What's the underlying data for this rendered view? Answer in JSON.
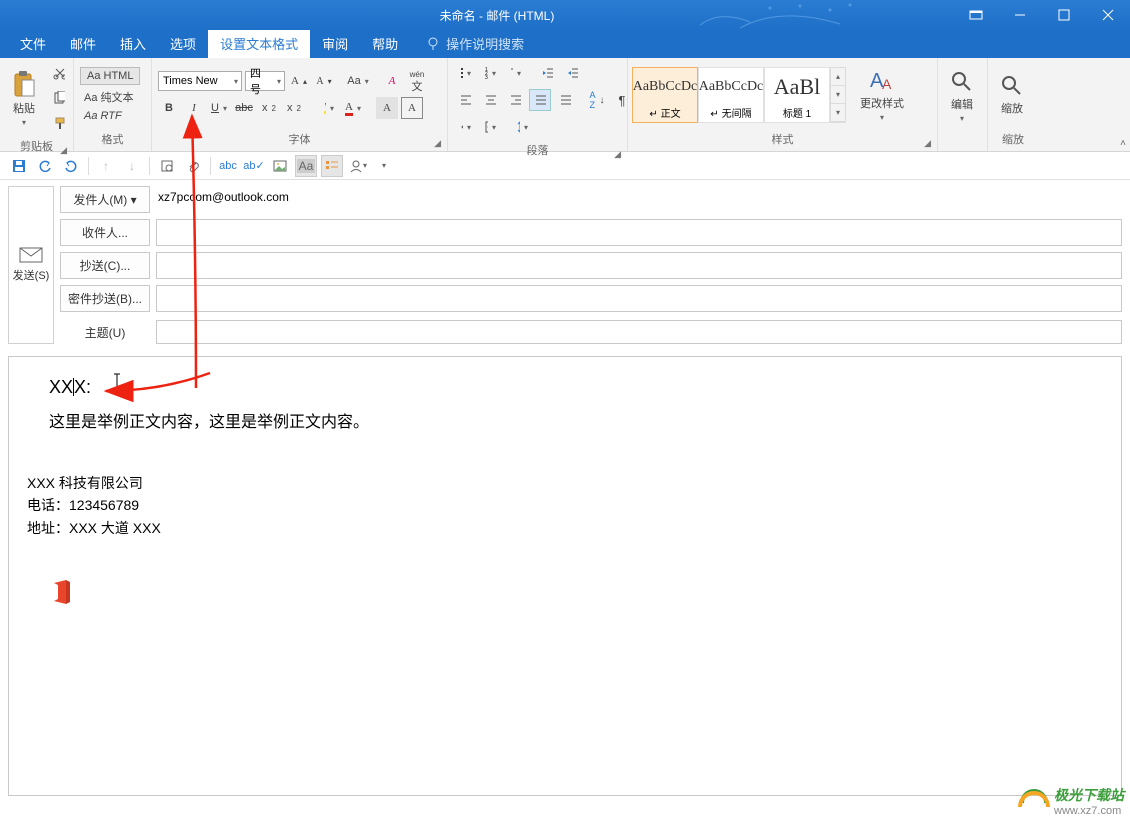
{
  "window": {
    "title": "未命名  -  邮件 (HTML)"
  },
  "tabs": {
    "file": "文件",
    "mail": "邮件",
    "insert": "插入",
    "options": "选项",
    "format": "设置文本格式",
    "review": "审阅",
    "help": "帮助",
    "tell_me": "操作说明搜索"
  },
  "ribbon": {
    "clipboard": {
      "paste": "粘贴",
      "label": "剪贴板"
    },
    "format_group": {
      "html": "Aa HTML",
      "plain": "Aa 纯文本",
      "rtf": "Aa RTF",
      "label": "格式"
    },
    "font": {
      "name": "Times New",
      "size": "四号",
      "label": "字体",
      "ruby": "wén"
    },
    "paragraph": {
      "label": "段落"
    },
    "styles": {
      "normal_preview": "AaBbCcDc",
      "normal_label": "↵ 正文",
      "nospace_preview": "AaBbCcDc",
      "nospace_label": "↵ 无间隔",
      "heading1_preview": "AaBl",
      "heading1_label": "标题 1",
      "change": "更改样式",
      "label": "样式"
    },
    "editing": {
      "label": "编辑"
    },
    "zoom": {
      "btn": "缩放",
      "label": "缩放"
    }
  },
  "header": {
    "send": "发送(S)",
    "from_btn": "发件人(M) ▾",
    "from_value": "xz7pccom@outlook.com",
    "to_btn": "收件人...",
    "cc_btn": "抄送(C)...",
    "bcc_btn": "密件抄送(B)...",
    "subject_label": "主题(U)"
  },
  "body": {
    "greeting": "XXX:",
    "content": "这里是举例正文内容，这里是举例正文内容。",
    "sig_company": "XXX 科技有限公司",
    "sig_phone": "电话：123456789",
    "sig_addr": "地址：XXX 大道 XXX"
  },
  "watermark": {
    "name": "极光下载站",
    "url": "www.xz7.com"
  }
}
